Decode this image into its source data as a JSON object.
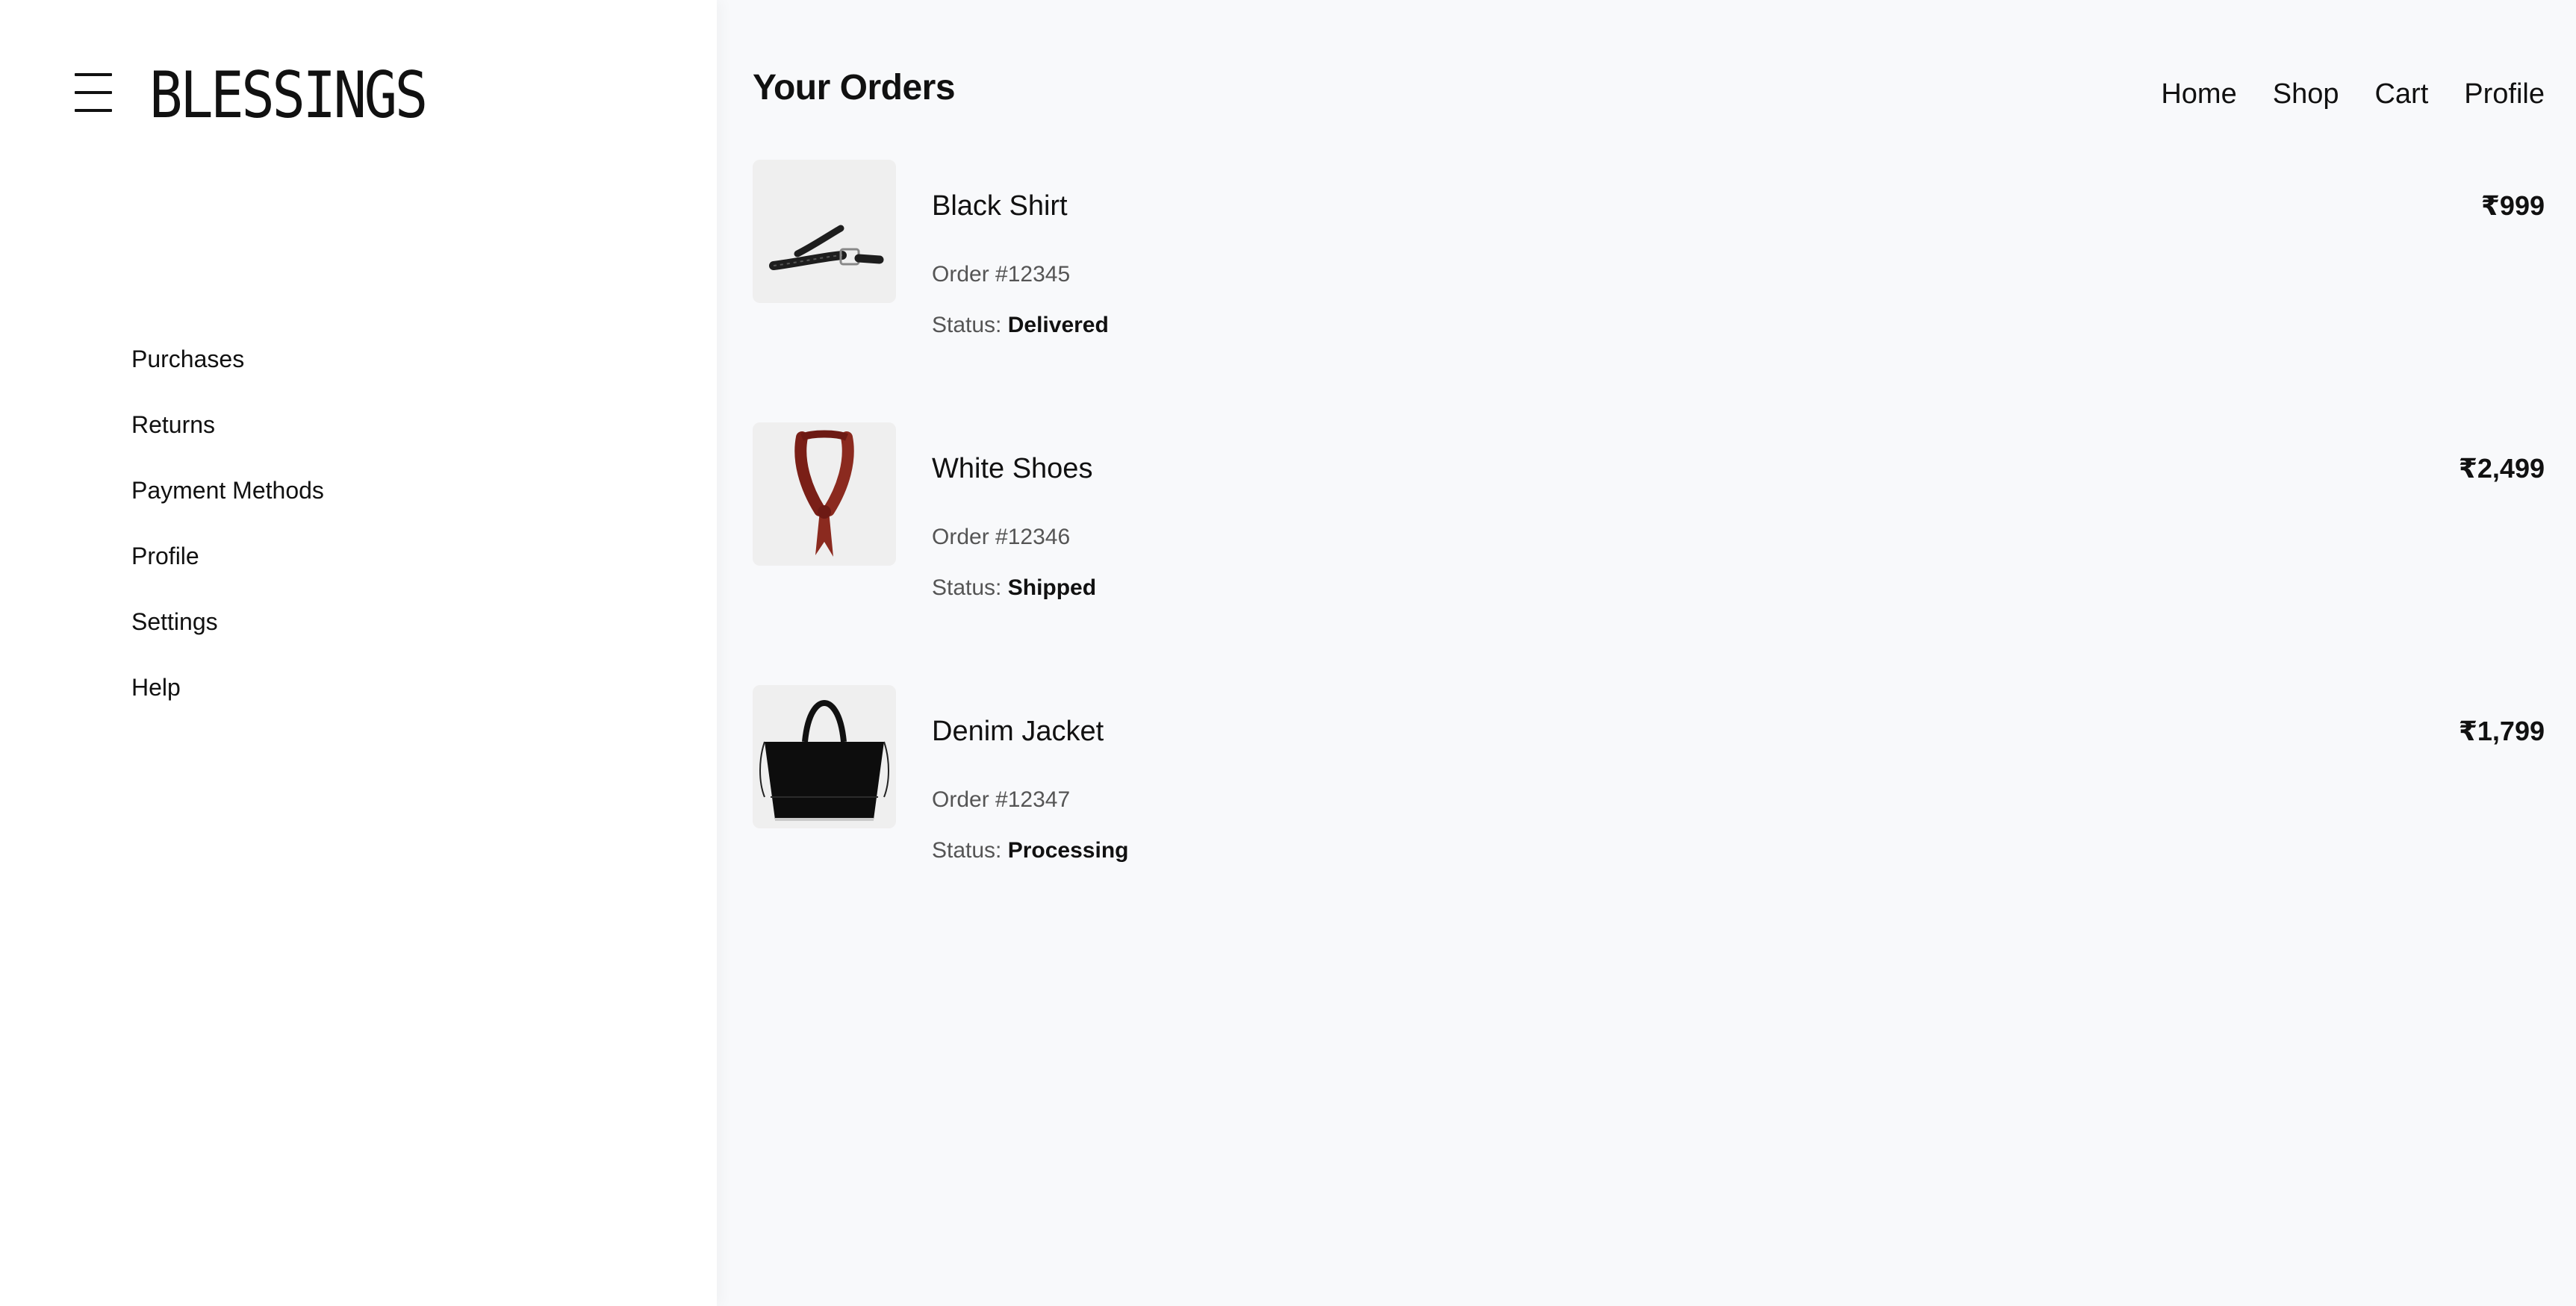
{
  "brand": {
    "name": "BLESSINGS",
    "menu_icon": "hamburger-menu-icon"
  },
  "sidebar": {
    "items": [
      {
        "label": "Purchases"
      },
      {
        "label": "Returns"
      },
      {
        "label": "Payment Methods"
      },
      {
        "label": "Profile"
      },
      {
        "label": "Settings"
      },
      {
        "label": "Help"
      }
    ]
  },
  "header": {
    "title": "Your Orders",
    "nav": [
      {
        "label": "Home"
      },
      {
        "label": "Shop"
      },
      {
        "label": "Cart"
      },
      {
        "label": "Profile"
      }
    ]
  },
  "orders": {
    "status_label": "Status:",
    "items": [
      {
        "name": "Black Shirt",
        "order_id": "Order #12345",
        "status": "Delivered",
        "price": "₹999",
        "image": "braided-belt-image"
      },
      {
        "name": "White Shoes",
        "order_id": "Order #12346",
        "status": "Shipped",
        "price": "₹2,499",
        "image": "red-neck-scarf-image"
      },
      {
        "name": "Denim Jacket",
        "order_id": "Order #12347",
        "status": "Processing",
        "price": "₹1,799",
        "image": "black-tote-bag-image"
      }
    ]
  },
  "colors": {
    "main_background": "#f8f9fb",
    "sidebar_background": "#ffffff",
    "text": "#111111",
    "muted_text": "#555555",
    "thumbnail_background": "#efefef"
  }
}
